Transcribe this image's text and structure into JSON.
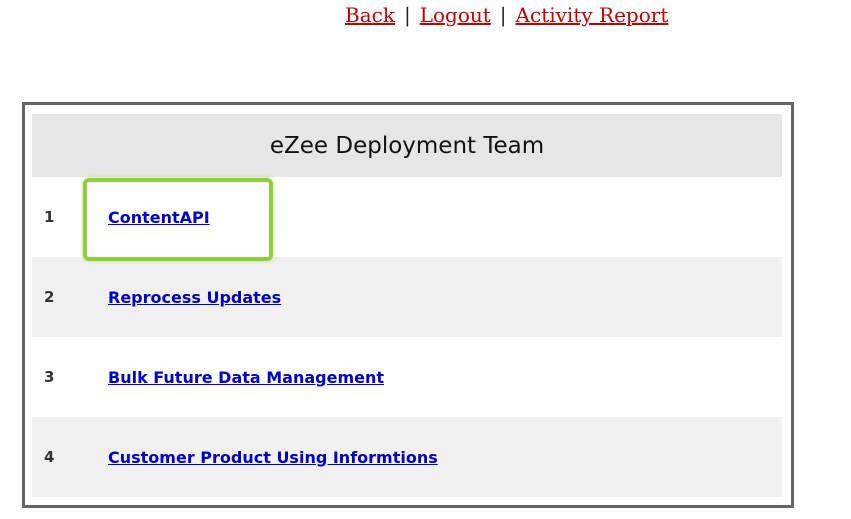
{
  "nav": {
    "links": [
      "Back",
      "Logout",
      "Activity Report"
    ],
    "separator": "|"
  },
  "panel": {
    "title": "eZee Deployment Team",
    "rows": [
      {
        "number": "1",
        "label": "ContentAPI"
      },
      {
        "number": "2",
        "label": "Reprocess Updates"
      },
      {
        "number": "3",
        "label": "Bulk Future Data Management"
      },
      {
        "number": "4",
        "label": "Customer Product Using Informtions"
      }
    ]
  },
  "colors": {
    "nav_link": "#c00000",
    "row_link": "#0000cc",
    "panel_border": "#656565",
    "title_bg": "#e6e6e6",
    "highlight": "#8fcf3c"
  }
}
